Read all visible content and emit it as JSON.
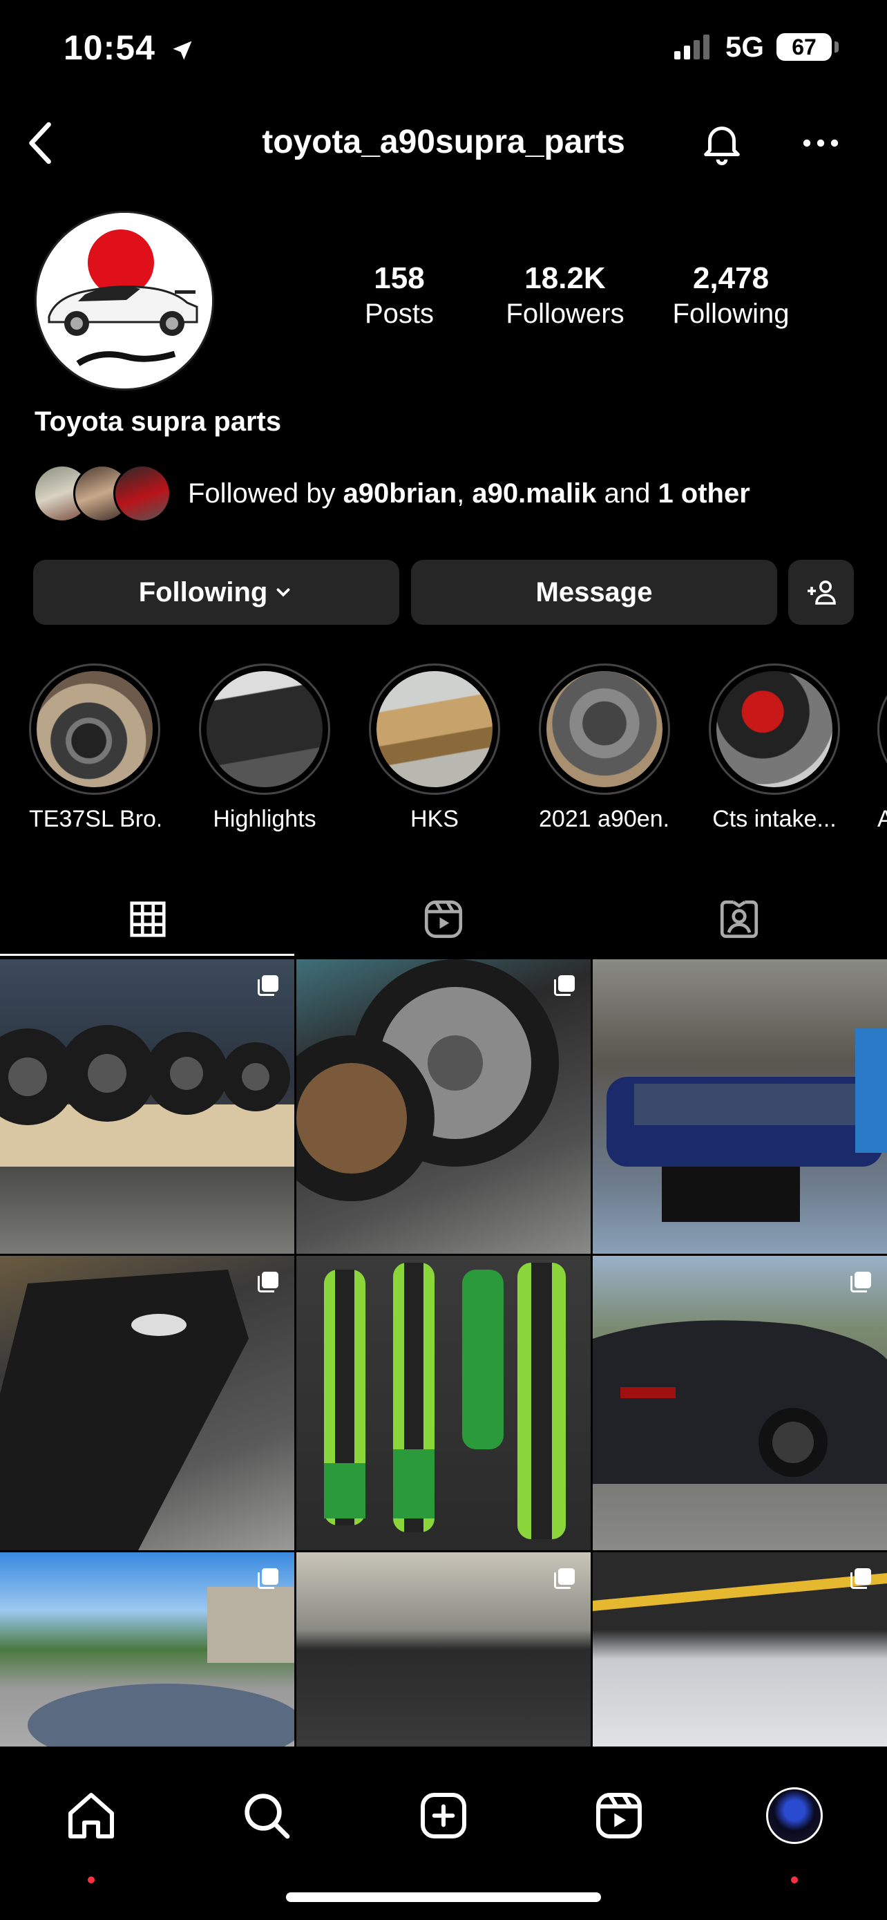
{
  "status": {
    "time": "10:54",
    "network": "5G",
    "battery": "67"
  },
  "header": {
    "username": "toyota_a90supra_parts"
  },
  "profile": {
    "display_name": "Toyota supra parts",
    "stats": [
      {
        "num": "158",
        "label": "Posts"
      },
      {
        "num": "18.2K",
        "label": "Followers"
      },
      {
        "num": "2,478",
        "label": "Following"
      }
    ],
    "followed_by": {
      "prefix": "Followed by ",
      "user1": "a90brian",
      "sep": ", ",
      "user2": "a90.malik",
      "mid": " and ",
      "others": "1 other"
    }
  },
  "buttons": {
    "following": "Following",
    "message": "Message"
  },
  "highlights": [
    {
      "label": "TE37SL Bro..."
    },
    {
      "label": "Highlights"
    },
    {
      "label": "HKS"
    },
    {
      "label": "2021 a90en..."
    },
    {
      "label": "Cts intake..."
    },
    {
      "label": "Ac"
    }
  ],
  "tabs": [
    "grid-icon",
    "reels-icon",
    "tagged-icon"
  ],
  "colors": {
    "background": "#000000",
    "button": "#262626",
    "notification_dot": "#ff3040",
    "avatar_sun": "#e0101a"
  }
}
